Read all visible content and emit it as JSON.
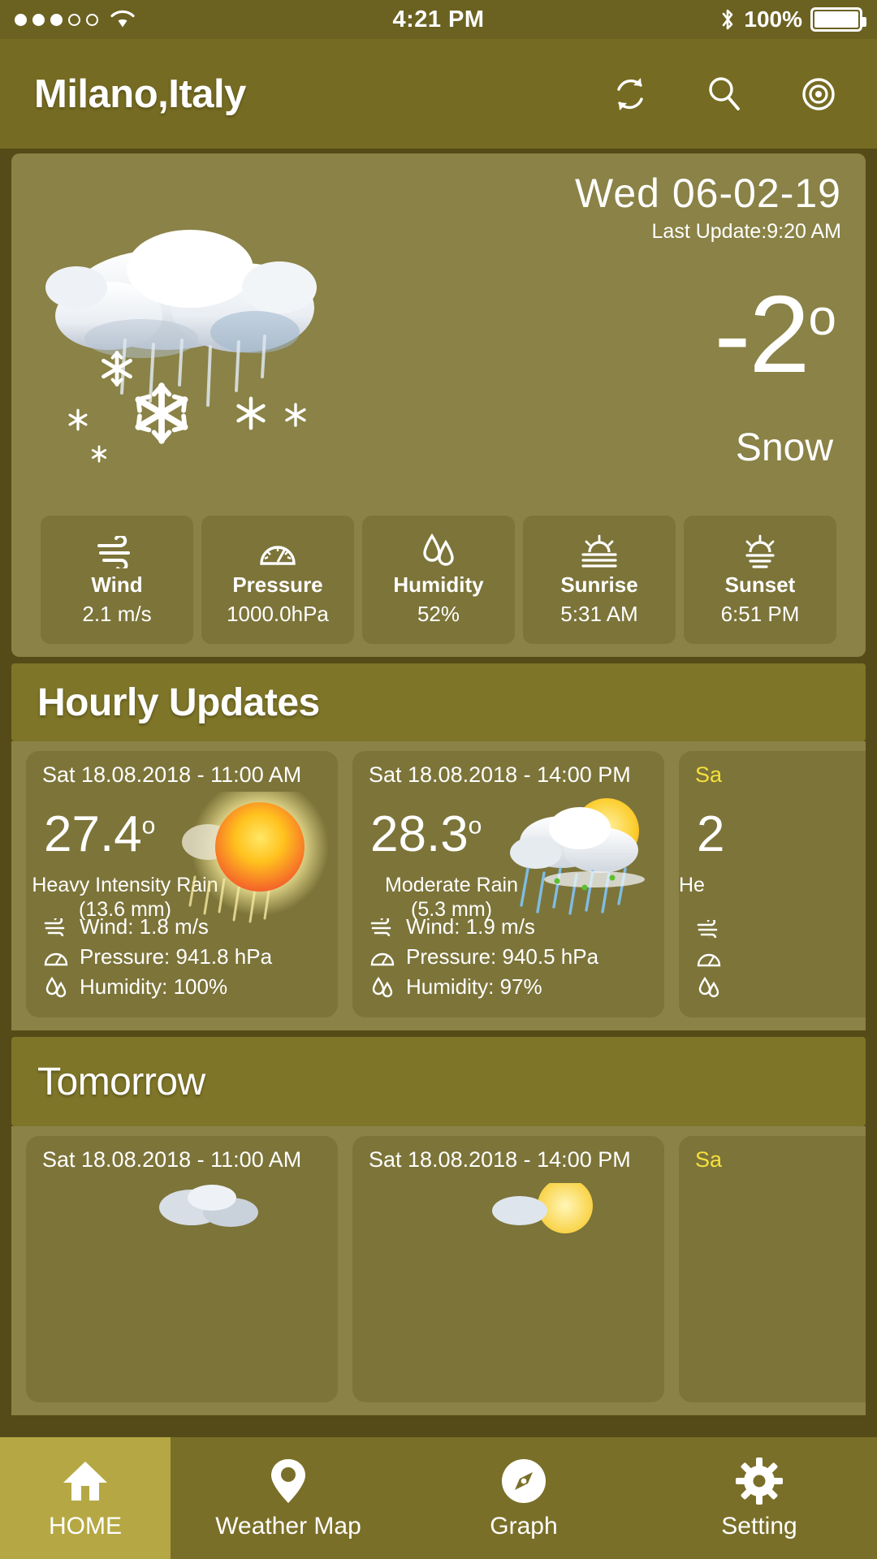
{
  "statusbar": {
    "signal_dots_filled": 3,
    "signal_dots_total": 5,
    "wifi_icon": "wifi-icon",
    "time": "4:21 PM",
    "bluetooth_icon": "bluetooth-icon",
    "battery_percent": "100%",
    "battery_icon": "battery-full-icon"
  },
  "header": {
    "city": "Milano,Italy",
    "refresh_icon": "refresh-icon",
    "search_icon": "search-icon",
    "location_icon": "target-location-icon"
  },
  "current": {
    "date": "Wed 06-02-19",
    "last_update": "Last Update:9:20 AM",
    "temperature": "-2",
    "degree": "o",
    "condition": "Snow",
    "weather_icon": "snow-cloud-icon",
    "stats": [
      {
        "icon": "wind-icon",
        "name": "Wind",
        "value": "2.1 m/s"
      },
      {
        "icon": "gauge-icon",
        "name": "Pressure",
        "value": "1000.0hPa"
      },
      {
        "icon": "humidity-icon",
        "name": "Humidity",
        "value": "52%"
      },
      {
        "icon": "sunrise-icon",
        "name": "Sunrise",
        "value": "5:31 AM"
      },
      {
        "icon": "sunset-icon",
        "name": "Sunset",
        "value": "6:51 PM"
      }
    ]
  },
  "hourly_section": {
    "title": "Hourly Updates",
    "cards": [
      {
        "date": "Sat 18.08.2018 - 11:00 AM",
        "date_highlight": false,
        "temp": "27.4",
        "degree": "o",
        "condition": "Heavy Intensity Rain",
        "amount": "(13.6 mm)",
        "icon": "sun-rain-icon",
        "wind": "Wind: 1.8 m/s",
        "pressure": "Pressure: 941.8 hPa",
        "humidity": "Humidity: 100%"
      },
      {
        "date": "Sat 18.08.2018 - 14:00 PM",
        "date_highlight": false,
        "temp": "28.3",
        "degree": "o",
        "condition": "Moderate Rain",
        "amount": "(5.3 mm)",
        "icon": "cloud-sun-rain-icon",
        "wind": "Wind: 1.9 m/s",
        "pressure": "Pressure: 940.5 hPa",
        "humidity": "Humidity: 97%"
      },
      {
        "date": "Sa",
        "date_highlight": true,
        "temp": "2",
        "degree": "",
        "condition": "He",
        "amount": "",
        "icon": "cloud-rain-icon",
        "wind": "",
        "pressure": "",
        "humidity": ""
      }
    ]
  },
  "tomorrow_section": {
    "title": "Tomorrow",
    "cards": [
      {
        "date": "Sat 18.08.2018 - 11:00 AM",
        "date_highlight": false,
        "icon": "cloud-icon"
      },
      {
        "date": "Sat 18.08.2018 - 14:00 PM",
        "date_highlight": false,
        "icon": "sun-cloud-icon"
      },
      {
        "date": "Sa",
        "date_highlight": true,
        "icon": "cloud-icon"
      }
    ]
  },
  "bottomnav": {
    "items": [
      {
        "icon": "home-icon",
        "label": "HOME",
        "active": true
      },
      {
        "icon": "map-pin-icon",
        "label": "Weather Map",
        "active": false
      },
      {
        "icon": "compass-icon",
        "label": "Graph",
        "active": false
      },
      {
        "icon": "gear-icon",
        "label": "Setting",
        "active": false
      }
    ]
  },
  "colors": {
    "statusbar": "#6B6222",
    "appbar": "#756B22",
    "page_bg": "#554B18",
    "card_bg": "#8A8246",
    "tile_bg": "#7C7439",
    "section_bg": "#7E7528",
    "nav_bg": "#7A6F28",
    "nav_active": "#B5A844",
    "highlight_text": "#F5E03C"
  }
}
